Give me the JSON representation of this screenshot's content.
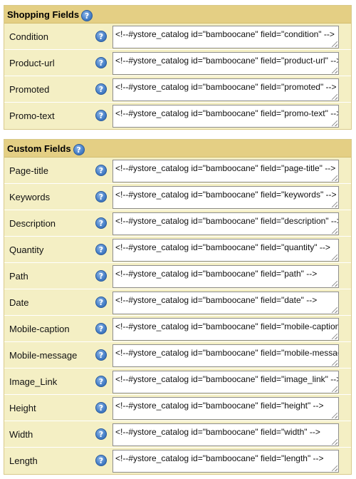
{
  "shopping": {
    "title": "Shopping Fields",
    "rows": [
      {
        "label": "Condition",
        "value": "<!--#ystore_catalog id=\"bamboocane\" field=\"condition\" -->"
      },
      {
        "label": "Product-url",
        "value": "<!--#ystore_catalog id=\"bamboocane\" field=\"product-url\" -->"
      },
      {
        "label": "Promoted",
        "value": "<!--#ystore_catalog id=\"bamboocane\" field=\"promoted\" -->"
      },
      {
        "label": "Promo-text",
        "value": "<!--#ystore_catalog id=\"bamboocane\" field=\"promo-text\" -->"
      }
    ]
  },
  "custom": {
    "title": "Custom Fields",
    "rows": [
      {
        "label": "Page-title",
        "value": "<!--#ystore_catalog id=\"bamboocane\" field=\"page-title\" -->"
      },
      {
        "label": "Keywords",
        "value": "<!--#ystore_catalog id=\"bamboocane\" field=\"keywords\" -->"
      },
      {
        "label": "Description",
        "value": "<!--#ystore_catalog id=\"bamboocane\" field=\"description\" -->"
      },
      {
        "label": "Quantity",
        "value": "<!--#ystore_catalog id=\"bamboocane\" field=\"quantity\" -->"
      },
      {
        "label": "Path",
        "value": "<!--#ystore_catalog id=\"bamboocane\" field=\"path\" -->"
      },
      {
        "label": "Date",
        "value": "<!--#ystore_catalog id=\"bamboocane\" field=\"date\" -->"
      },
      {
        "label": "Mobile-caption",
        "value": "<!--#ystore_catalog id=\"bamboocane\" field=\"mobile-caption\" -->"
      },
      {
        "label": "Mobile-message",
        "value": "<!--#ystore_catalog id=\"bamboocane\" field=\"mobile-message\" -->"
      },
      {
        "label": "Image_Link",
        "value": "<!--#ystore_catalog id=\"bamboocane\" field=\"image_link\" -->"
      },
      {
        "label": "Height",
        "value": "<!--#ystore_catalog id=\"bamboocane\" field=\"height\" -->"
      },
      {
        "label": "Width",
        "value": "<!--#ystore_catalog id=\"bamboocane\" field=\"width\" -->"
      },
      {
        "label": "Length",
        "value": "<!--#ystore_catalog id=\"bamboocane\" field=\"length\" -->"
      }
    ]
  },
  "help_glyph": "?",
  "icons": {
    "help": "help-question-icon",
    "resize": "resize-grip-icon"
  },
  "colors": {
    "section_bg": "#f4efc4",
    "header_bg": "#e4cf84",
    "help_blue": "#4a82c9"
  }
}
